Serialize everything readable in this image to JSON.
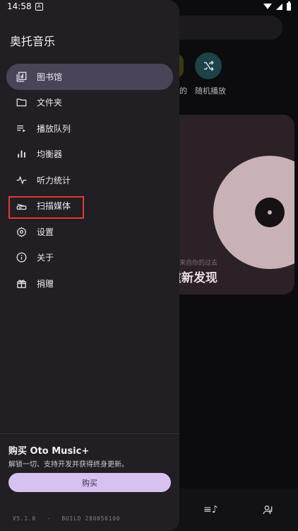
{
  "status_bar": {
    "time": "14:58",
    "notification_glyph": "A"
  },
  "background": {
    "chip_label_left": "的",
    "shuffle_label": "随机播放",
    "card_subtitle": "来自你的过去",
    "card_title": "重新发现"
  },
  "drawer": {
    "title": "奥托音乐",
    "items": [
      {
        "label": "图书馆",
        "icon": "library-icon"
      },
      {
        "label": "文件夹",
        "icon": "folder-icon"
      },
      {
        "label": "播放队列",
        "icon": "queue-icon"
      },
      {
        "label": "均衡器",
        "icon": "equalizer-icon"
      },
      {
        "label": "听力统计",
        "icon": "stats-pulse-icon"
      },
      {
        "label": "扫描媒体",
        "icon": "scanner-icon"
      },
      {
        "label": "设置",
        "icon": "gear-icon"
      },
      {
        "label": "关于",
        "icon": "info-icon"
      },
      {
        "label": "捐赠",
        "icon": "gift-icon"
      }
    ],
    "active_item": "图书馆",
    "buy": {
      "title": "购买 Oto Music+",
      "description": "解锁一切、支持开发并获得终身更新。",
      "button_label": "购买"
    },
    "version": {
      "version": "V5.1.0",
      "separator": "·",
      "build": "BUILD 280050100"
    }
  },
  "colors": {
    "drawer_bg": "#211e24",
    "active_item_bg": "#4b4459",
    "buy_button_bg": "#d6c2f0",
    "highlight_box": "#e53935"
  }
}
